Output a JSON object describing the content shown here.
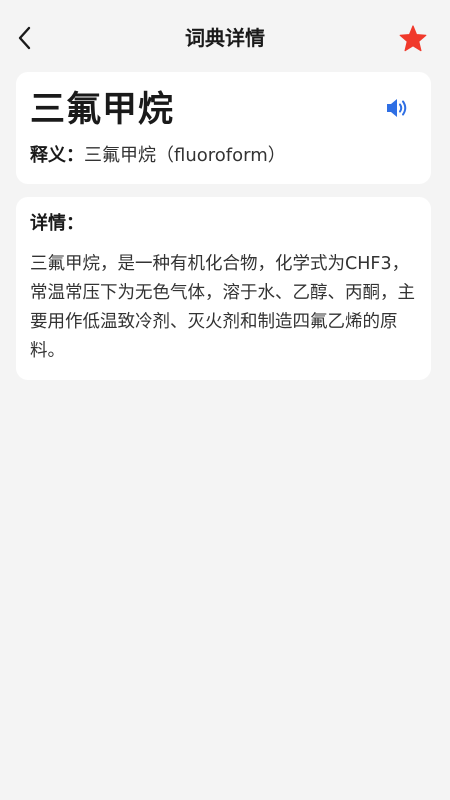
{
  "header": {
    "title": "词典详情",
    "back_icon": "chevron-left-icon",
    "favorite_icon": "star-filled-icon",
    "favorite_color": "#f0392b"
  },
  "entry": {
    "word": "三氟甲烷",
    "speaker_icon": "speaker-volume-icon",
    "speaker_color": "#2f6fe4",
    "meaning_label": "释义：",
    "meaning": "三氟甲烷（fluoroform）"
  },
  "details": {
    "label": "详情：",
    "text": "三氟甲烷，是一种有机化合物，化学式为CHF3，常温常压下为无色气体，溶于水、乙醇、丙酮，主要用作低温致冷剂、灭火剂和制造四氟乙烯的原料。"
  }
}
